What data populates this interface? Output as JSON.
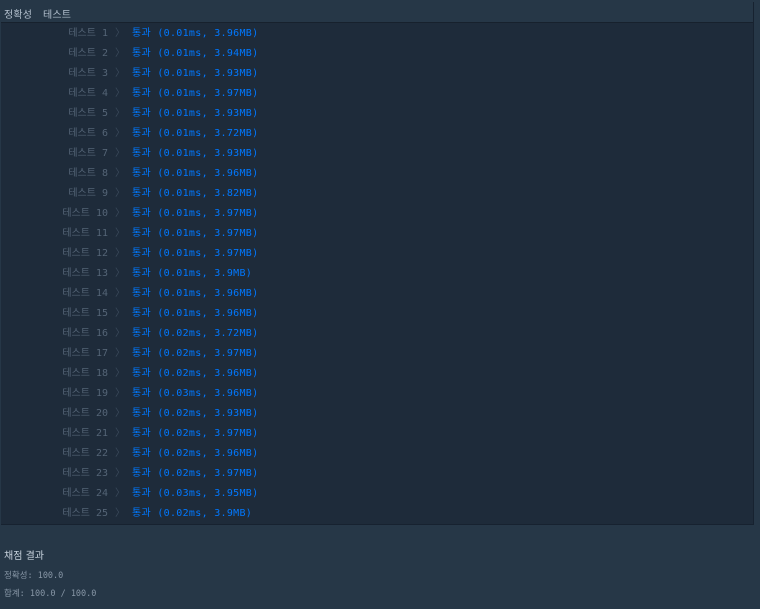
{
  "tabs": {
    "accuracy": "정확성",
    "test": "테스트"
  },
  "results": [
    {
      "label": "테스트 1",
      "result": "통과 (0.01ms, 3.96MB)"
    },
    {
      "label": "테스트 2",
      "result": "통과 (0.01ms, 3.94MB)"
    },
    {
      "label": "테스트 3",
      "result": "통과 (0.01ms, 3.93MB)"
    },
    {
      "label": "테스트 4",
      "result": "통과 (0.01ms, 3.97MB)"
    },
    {
      "label": "테스트 5",
      "result": "통과 (0.01ms, 3.93MB)"
    },
    {
      "label": "테스트 6",
      "result": "통과 (0.01ms, 3.72MB)"
    },
    {
      "label": "테스트 7",
      "result": "통과 (0.01ms, 3.93MB)"
    },
    {
      "label": "테스트 8",
      "result": "통과 (0.01ms, 3.96MB)"
    },
    {
      "label": "테스트 9",
      "result": "통과 (0.01ms, 3.82MB)"
    },
    {
      "label": "테스트 10",
      "result": "통과 (0.01ms, 3.97MB)"
    },
    {
      "label": "테스트 11",
      "result": "통과 (0.01ms, 3.97MB)"
    },
    {
      "label": "테스트 12",
      "result": "통과 (0.01ms, 3.97MB)"
    },
    {
      "label": "테스트 13",
      "result": "통과 (0.01ms, 3.9MB)"
    },
    {
      "label": "테스트 14",
      "result": "통과 (0.01ms, 3.96MB)"
    },
    {
      "label": "테스트 15",
      "result": "통과 (0.01ms, 3.96MB)"
    },
    {
      "label": "테스트 16",
      "result": "통과 (0.02ms, 3.72MB)"
    },
    {
      "label": "테스트 17",
      "result": "통과 (0.02ms, 3.97MB)"
    },
    {
      "label": "테스트 18",
      "result": "통과 (0.02ms, 3.96MB)"
    },
    {
      "label": "테스트 19",
      "result": "통과 (0.03ms, 3.96MB)"
    },
    {
      "label": "테스트 20",
      "result": "통과 (0.02ms, 3.93MB)"
    },
    {
      "label": "테스트 21",
      "result": "통과 (0.02ms, 3.97MB)"
    },
    {
      "label": "테스트 22",
      "result": "통과 (0.02ms, 3.96MB)"
    },
    {
      "label": "테스트 23",
      "result": "통과 (0.02ms, 3.97MB)"
    },
    {
      "label": "테스트 24",
      "result": "통과 (0.03ms, 3.95MB)"
    },
    {
      "label": "테스트 25",
      "result": "통과 (0.02ms, 3.9MB)"
    }
  ],
  "chevron": "〉",
  "summary": {
    "title": "채점 결과",
    "accuracy": "정확성: 100.0",
    "total": "합계: 100.0 / 100.0"
  },
  "colors": {
    "background": "#263747",
    "panel": "#1e2b3a",
    "pass": "#0078ff",
    "label": "#546476"
  }
}
